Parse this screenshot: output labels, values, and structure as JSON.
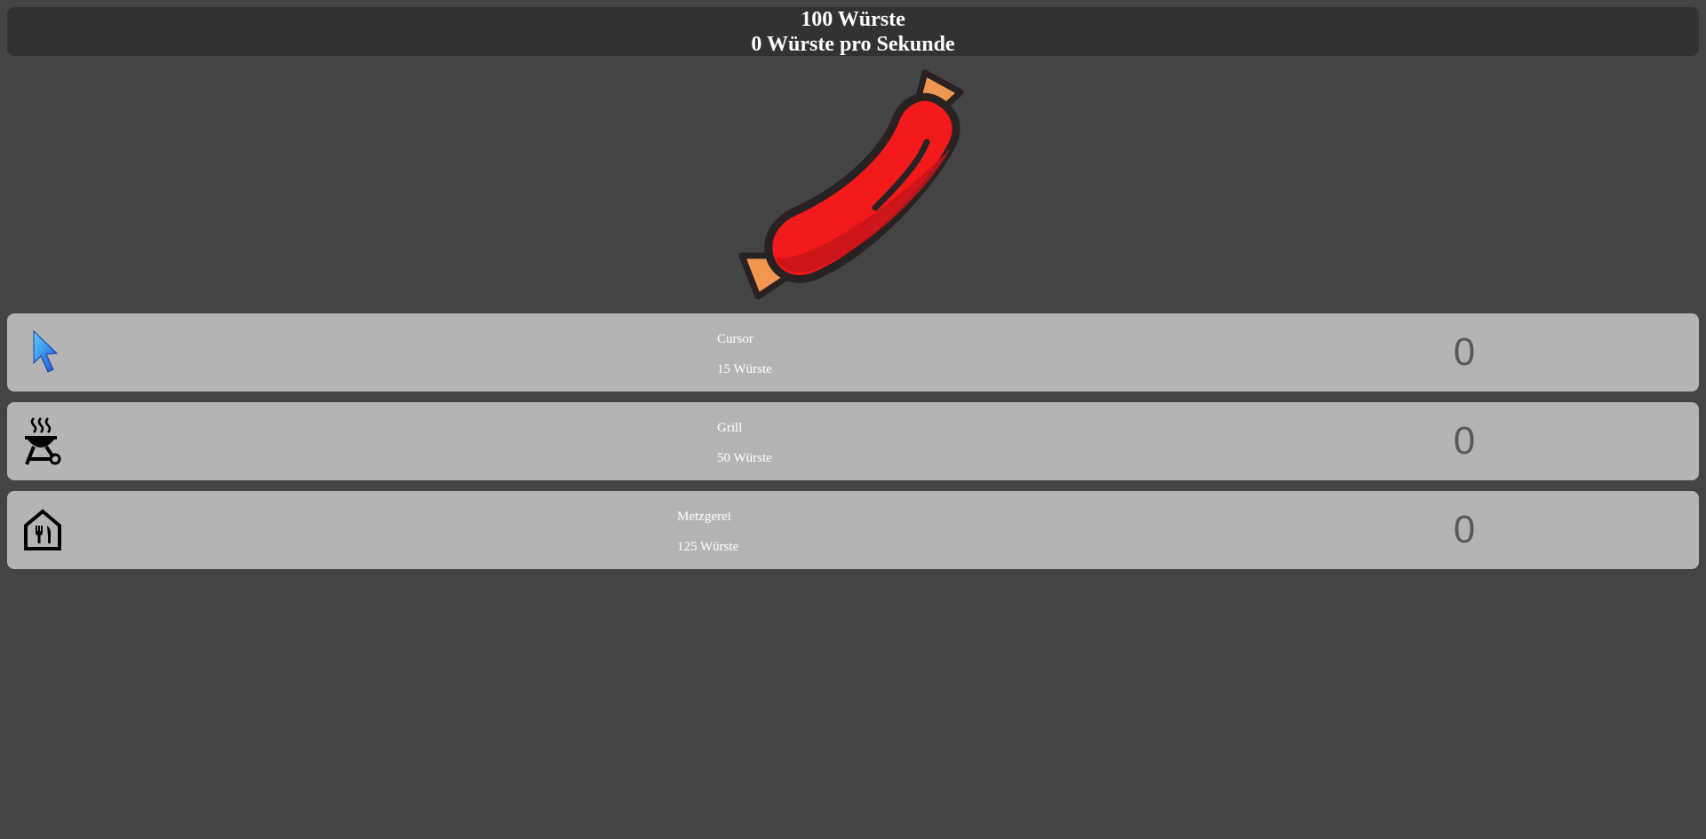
{
  "header": {
    "sausage_count": "100 Würste",
    "per_second": "0 Würste pro Sekunde"
  },
  "colors": {
    "background": "#444444",
    "header_bg": "#323232",
    "item_bg": "#b4b4b4",
    "sausage_red": "#f21a1a",
    "sausage_tip": "#ef9650",
    "outline": "#2a2222"
  },
  "shop": {
    "items": [
      {
        "icon": "cursor-icon",
        "name": "Cursor",
        "price": "15 Würste",
        "count": "0"
      },
      {
        "icon": "grill-icon",
        "name": "Grill",
        "price": "50 Würste",
        "count": "0"
      },
      {
        "icon": "butcher-shop-icon",
        "name": "Metzgerei",
        "price": "125 Würste",
        "count": "0"
      }
    ]
  }
}
